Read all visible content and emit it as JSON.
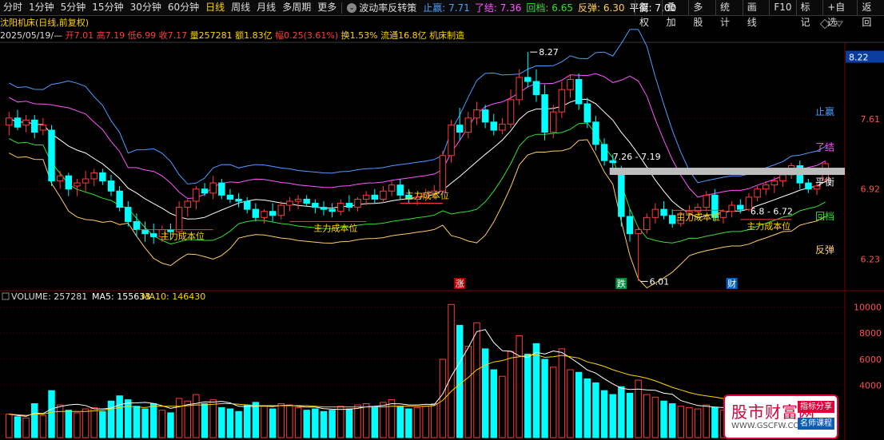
{
  "toolbar": {
    "timeframes": [
      "分时",
      "1分钟",
      "5分钟",
      "15分钟",
      "30分钟",
      "60分钟",
      "日线",
      "周线",
      "月线",
      "多周期",
      "更多"
    ],
    "active_timeframe": "日线",
    "indicator_name": "波动率反转策",
    "indicator_values": [
      {
        "label": "止赢: 7.71",
        "color": "#4f9cff"
      },
      {
        "label": "了结: 7.36",
        "color": "#ff56ff"
      },
      {
        "label": "回档: 6.65",
        "color": "#33dd33"
      },
      {
        "label": "反弹: 6.30",
        "color": "#ffcc66"
      },
      {
        "label": "平衡: 7.00",
        "color": "#ffffff"
      }
    ],
    "right_buttons": [
      "复权",
      "叠加",
      "多股",
      "统计",
      "画线",
      "F10",
      "标记",
      "+自选",
      "返回"
    ]
  },
  "stock": {
    "title": "沈阳机床(日线,前复权)",
    "date": "2025/05/19/—",
    "open": "开7.01",
    "high": "高7.19",
    "low": "低6.99",
    "close": "收7.17",
    "volume": "量257281",
    "amount": "额1.83亿",
    "change": "幅0.25(3.61%)",
    "turnover": "换1.53%",
    "float": "流通16.8亿",
    "sector": "机床制造"
  },
  "price_axis": {
    "labels": [
      "8.22",
      "7.61",
      "6.92",
      "6.23"
    ],
    "current_price": "8.22"
  },
  "volume_axis": {
    "labels": [
      "10000",
      "8000",
      "6000",
      "4000"
    ]
  },
  "annotations": {
    "high_marker": "8.27",
    "low_marker": "6.01",
    "range_label": "7.26 - 7.19",
    "range_label_2": "6.8 - 6.72",
    "cost_labels": [
      "主力成本位",
      "主力成本位",
      "主力成本位",
      "主力成本位",
      "主力成本位"
    ],
    "event_marks": [
      "涨",
      "跌",
      "财"
    ],
    "band_labels": [
      "止赢",
      "了结",
      "平衡",
      "回档",
      "反弹"
    ]
  },
  "volume_header": {
    "name": "VOLUME: 257281",
    "ma5": "MA5: 155633",
    "ma10": "MA10: 146430"
  },
  "watermark": {
    "site": "股市财富网",
    "url": "WWW.GSCFW.COM",
    "tag1": "指标分享",
    "tag2": "名师课程"
  },
  "colors": {
    "up": "#ff3b3b",
    "down": "#00ffff",
    "stop": "#4f9cff",
    "exit": "#ff56ff",
    "balance": "#ffffff",
    "pullback": "#33dd33",
    "rebound": "#ffcc66",
    "cost": "#ff3b3b",
    "cost_text": "#ffd400"
  },
  "chart_data": {
    "type": "candlestick",
    "ylim": [
      5.95,
      8.35
    ],
    "volume_ylim": [
      0,
      10400
    ],
    "candles": [
      [
        7.55,
        7.68,
        7.45,
        7.62
      ],
      [
        7.62,
        7.7,
        7.5,
        7.53
      ],
      [
        7.55,
        7.65,
        7.48,
        7.6
      ],
      [
        7.6,
        7.65,
        7.42,
        7.48
      ],
      [
        7.5,
        7.62,
        7.45,
        7.55
      ],
      [
        7.5,
        7.55,
        6.95,
        7.0
      ],
      [
        7.0,
        7.1,
        6.92,
        7.05
      ],
      [
        7.05,
        7.08,
        6.85,
        6.92
      ],
      [
        6.95,
        7.02,
        6.85,
        6.98
      ],
      [
        6.98,
        7.1,
        6.9,
        7.02
      ],
      [
        7.02,
        7.12,
        6.95,
        7.08
      ],
      [
        7.08,
        7.12,
        6.96,
        7.0
      ],
      [
        7.0,
        7.06,
        6.85,
        6.9
      ],
      [
        6.9,
        6.95,
        6.7,
        6.74
      ],
      [
        6.74,
        6.8,
        6.55,
        6.6
      ],
      [
        6.6,
        6.68,
        6.45,
        6.52
      ],
      [
        6.52,
        6.6,
        6.4,
        6.48
      ],
      [
        6.48,
        6.58,
        6.38,
        6.45
      ],
      [
        6.45,
        6.56,
        6.4,
        6.52
      ],
      [
        6.52,
        6.58,
        6.42,
        6.5
      ],
      [
        6.5,
        6.8,
        6.45,
        6.74
      ],
      [
        6.74,
        6.82,
        6.65,
        6.8
      ],
      [
        6.8,
        6.95,
        6.72,
        6.92
      ],
      [
        6.92,
        6.98,
        6.85,
        6.88
      ],
      [
        6.88,
        7.05,
        6.82,
        6.98
      ],
      [
        6.98,
        7.02,
        6.82,
        6.86
      ],
      [
        6.86,
        6.92,
        6.78,
        6.82
      ],
      [
        6.82,
        6.88,
        6.74,
        6.8
      ],
      [
        6.8,
        6.84,
        6.68,
        6.72
      ],
      [
        6.72,
        6.78,
        6.6,
        6.64
      ],
      [
        6.64,
        6.72,
        6.58,
        6.7
      ],
      [
        6.7,
        6.78,
        6.6,
        6.66
      ],
      [
        6.66,
        6.8,
        6.62,
        6.76
      ],
      [
        6.76,
        6.84,
        6.7,
        6.8
      ],
      [
        6.8,
        6.86,
        6.72,
        6.82
      ],
      [
        6.82,
        6.86,
        6.75,
        6.78
      ],
      [
        6.78,
        6.82,
        6.68,
        6.74
      ],
      [
        6.74,
        6.8,
        6.66,
        6.72
      ],
      [
        6.72,
        6.78,
        6.64,
        6.7
      ],
      [
        6.7,
        6.82,
        6.66,
        6.78
      ],
      [
        6.78,
        6.86,
        6.7,
        6.74
      ],
      [
        6.74,
        6.84,
        6.7,
        6.82
      ],
      [
        6.82,
        6.9,
        6.76,
        6.86
      ],
      [
        6.86,
        6.92,
        6.78,
        6.82
      ],
      [
        6.82,
        6.95,
        6.78,
        6.9
      ],
      [
        6.9,
        7.0,
        6.85,
        6.96
      ],
      [
        6.96,
        7.02,
        6.82,
        6.86
      ],
      [
        6.86,
        6.92,
        6.78,
        6.82
      ],
      [
        6.82,
        6.88,
        6.76,
        6.84
      ],
      [
        6.84,
        6.92,
        6.8,
        6.88
      ],
      [
        6.88,
        6.96,
        6.82,
        6.9
      ],
      [
        6.9,
        7.3,
        6.88,
        7.25
      ],
      [
        7.25,
        7.6,
        7.18,
        7.55
      ],
      [
        7.55,
        7.72,
        7.4,
        7.48
      ],
      [
        7.48,
        7.68,
        7.42,
        7.62
      ],
      [
        7.62,
        7.78,
        7.55,
        7.7
      ],
      [
        7.7,
        7.75,
        7.52,
        7.58
      ],
      [
        7.58,
        7.66,
        7.45,
        7.5
      ],
      [
        7.5,
        7.62,
        7.46,
        7.56
      ],
      [
        7.56,
        7.9,
        7.52,
        7.8
      ],
      [
        7.8,
        8.1,
        7.75,
        8.02
      ],
      [
        8.02,
        8.27,
        7.92,
        7.98
      ],
      [
        7.98,
        8.1,
        7.78,
        7.85
      ],
      [
        7.85,
        7.95,
        7.4,
        7.48
      ],
      [
        7.48,
        7.75,
        7.42,
        7.68
      ],
      [
        7.68,
        7.98,
        7.62,
        7.9
      ],
      [
        7.9,
        8.05,
        7.82,
        8.0
      ],
      [
        8.0,
        8.06,
        7.7,
        7.76
      ],
      [
        7.76,
        7.82,
        7.52,
        7.58
      ],
      [
        7.58,
        7.64,
        7.3,
        7.36
      ],
      [
        7.36,
        7.42,
        7.15,
        7.2
      ],
      [
        7.2,
        7.26,
        7.12,
        7.18
      ],
      [
        7.1,
        7.15,
        6.55,
        6.65
      ],
      [
        6.65,
        6.72,
        6.4,
        6.48
      ],
      [
        6.48,
        6.55,
        6.01,
        6.52
      ],
      [
        6.52,
        6.68,
        6.48,
        6.64
      ],
      [
        6.64,
        6.78,
        6.58,
        6.72
      ],
      [
        6.72,
        6.8,
        6.62,
        6.66
      ],
      [
        6.66,
        6.72,
        6.54,
        6.58
      ],
      [
        6.58,
        6.7,
        6.55,
        6.68
      ],
      [
        6.68,
        6.76,
        6.6,
        6.7
      ],
      [
        6.7,
        6.78,
        6.64,
        6.74
      ],
      [
        6.74,
        6.9,
        6.7,
        6.86
      ],
      [
        6.86,
        6.92,
        6.6,
        6.64
      ],
      [
        6.64,
        6.72,
        6.58,
        6.7
      ],
      [
        6.7,
        6.8,
        6.64,
        6.76
      ],
      [
        6.76,
        6.82,
        6.68,
        6.72
      ],
      [
        6.72,
        6.88,
        6.7,
        6.84
      ],
      [
        6.84,
        6.95,
        6.8,
        6.92
      ],
      [
        6.92,
        7.0,
        6.86,
        6.96
      ],
      [
        6.96,
        7.04,
        6.88,
        7.0
      ],
      [
        7.0,
        7.1,
        6.94,
        7.06
      ],
      [
        7.06,
        7.18,
        7.02,
        7.15
      ],
      [
        7.15,
        7.2,
        6.92,
        6.98
      ],
      [
        6.98,
        7.02,
        6.88,
        6.92
      ],
      [
        6.92,
        6.98,
        6.86,
        6.95
      ],
      [
        7.01,
        7.19,
        6.99,
        7.17
      ]
    ],
    "volume": [
      1800,
      1600,
      1500,
      2600,
      1700,
      3600,
      2500,
      2100,
      1900,
      2200,
      2300,
      2000,
      2800,
      3200,
      2900,
      2400,
      2200,
      2600,
      2100,
      1900,
      3000,
      2800,
      3300,
      2600,
      2900,
      2300,
      2200,
      2000,
      2500,
      2700,
      2400,
      2200,
      2600,
      2500,
      2300,
      2100,
      2200,
      2000,
      2100,
      2400,
      2200,
      2500,
      2600,
      2300,
      2700,
      2900,
      2400,
      2200,
      2300,
      2400,
      2600,
      6000,
      10200,
      8600,
      7000,
      8800,
      6800,
      5200,
      4700,
      6600,
      7800,
      6400,
      7200,
      6000,
      5400,
      6800,
      5200,
      5000,
      4500,
      4200,
      3600,
      3300,
      3900,
      3400,
      4400,
      3300,
      3100,
      2800,
      2600,
      2400,
      2300,
      2200,
      2500,
      2300,
      2100,
      2200,
      2100,
      2300,
      2200,
      2100,
      2400,
      2200,
      2600,
      2400,
      2200,
      2300,
      2600
    ],
    "ma5": [
      1800,
      1700,
      1630,
      1870,
      1840,
      2200,
      2380,
      2500,
      2560,
      2460,
      2200,
      2200,
      2260,
      2520,
      2640,
      2660,
      2700,
      2620,
      2440,
      2240,
      2360,
      2520,
      2620,
      2740,
      2720,
      2780,
      2660,
      2400,
      2380,
      2400,
      2420,
      2380,
      2460,
      2480,
      2400,
      2340,
      2340,
      2220,
      2180,
      2160,
      2180,
      2240,
      2360,
      2400,
      2460,
      2600,
      2580,
      2500,
      2500,
      2560,
      2520,
      3340,
      4700,
      5760,
      6880,
      8120,
      8280,
      7280,
      6660,
      6620,
      6260,
      6140,
      6540,
      6400,
      6640,
      6520,
      6120,
      5680,
      5180,
      4940,
      4500,
      4120,
      3780,
      3680,
      3720,
      3660,
      3620,
      3400,
      3320,
      2840,
      2640,
      2460,
      2400,
      2340,
      2300,
      2260,
      2200,
      2180,
      2160,
      2140,
      2220,
      2240,
      2300,
      2320,
      2360,
      2340,
      2400
    ],
    "ma10": [
      1800,
      1750,
      1700,
      1800,
      1800,
      1950,
      2000,
      2000,
      2000,
      2000,
      2050,
      2100,
      2200,
      2300,
      2400,
      2350,
      2300,
      2400,
      2400,
      2400,
      2400,
      2450,
      2500,
      2500,
      2550,
      2600,
      2600,
      2550,
      2500,
      2450,
      2450,
      2450,
      2450,
      2450,
      2450,
      2450,
      2400,
      2350,
      2350,
      2350,
      2350,
      2350,
      2350,
      2350,
      2350,
      2400,
      2400,
      2400,
      2400,
      2400,
      2450,
      2850,
      3550,
      4100,
      4600,
      5200,
      5550,
      5800,
      5900,
      6100,
      6200,
      6300,
      6350,
      6150,
      6200,
      6300,
      6200,
      6100,
      5800,
      5650,
      5450,
      5200,
      5000,
      4800,
      4700,
      4550,
      4350,
      4100,
      3850,
      3650,
      3450,
      3300,
      3200,
      3100,
      3000,
      2900,
      2800,
      2650,
      2550,
      2450,
      2450,
      2400,
      2400,
      2400,
      2350,
      2350,
      2350
    ]
  }
}
